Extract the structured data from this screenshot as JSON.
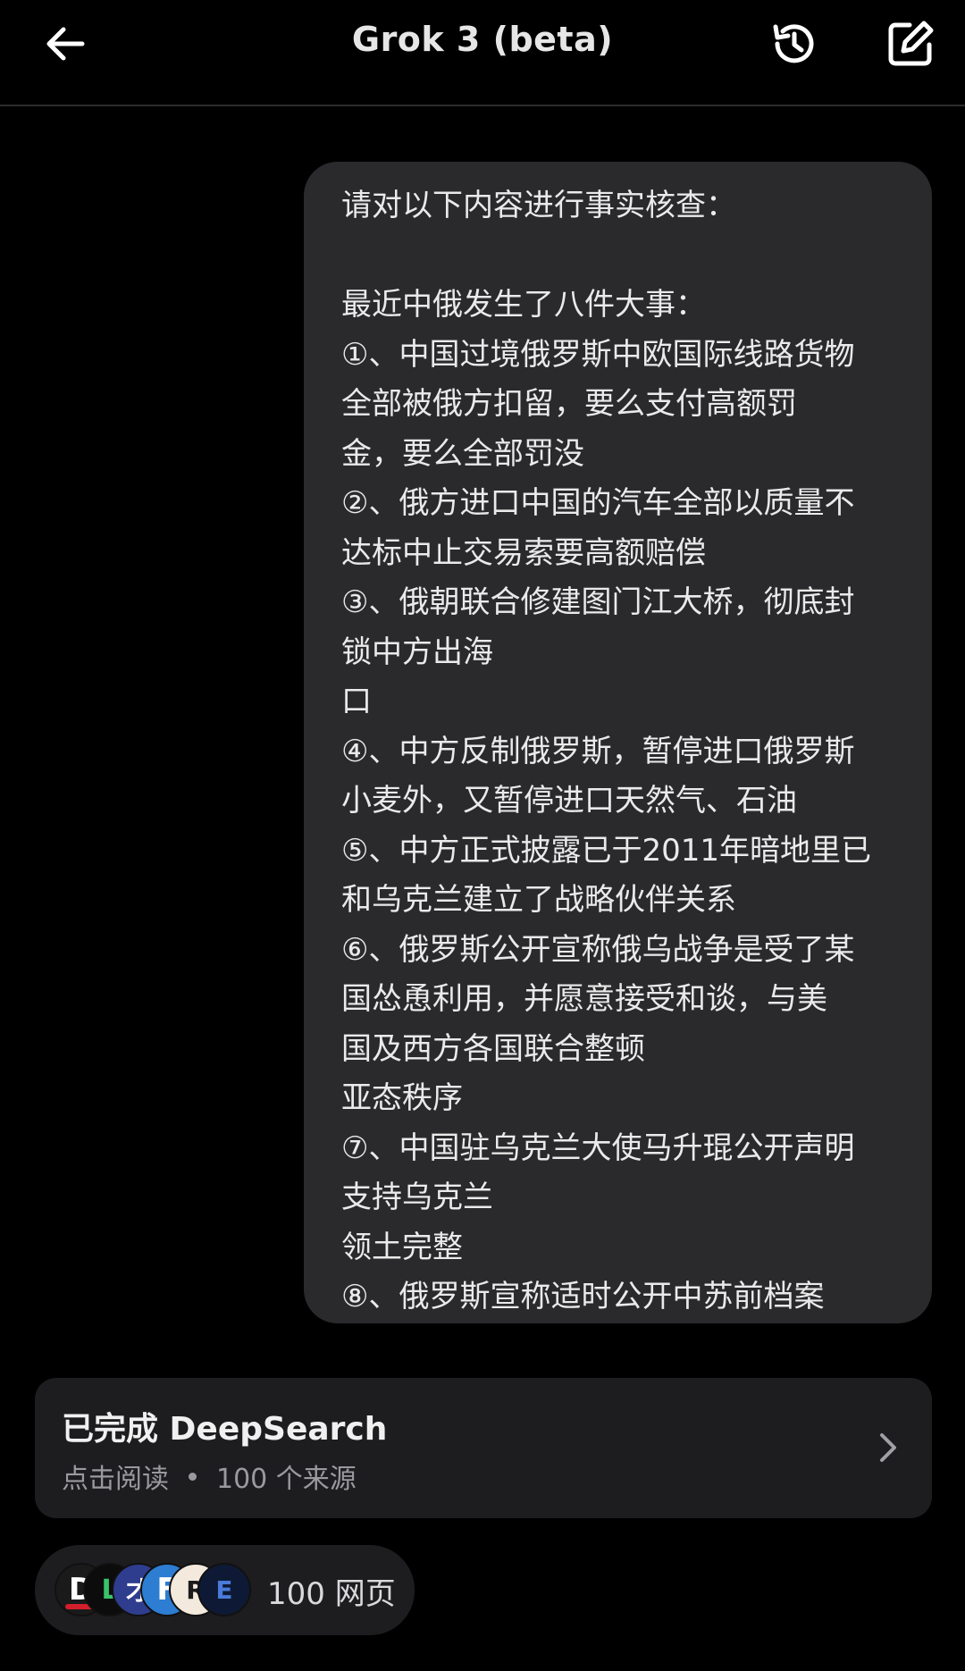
{
  "header": {
    "title": "Grok 3 (beta)",
    "back_icon": "arrow-left-icon",
    "history_icon": "history-icon",
    "compose_icon": "compose-icon"
  },
  "message": {
    "text": "请对以下内容进行事实核查：\n\n最近中俄发生了八件大事：\n①、中国过境俄罗斯中欧国际线路货物\n全部被俄方扣留，要么支付高额罚\n金，要么全部罚没\n②、俄方进口中国的汽车全部以质量不\n达标中止交易索要高额赔偿\n③、俄朝联合修建图门江大桥，彻底封\n锁中方出海\n口\n④、中方反制俄罗斯，暂停进口俄罗斯\n小麦外，又暂停进口天然气、石油\n⑤、中方正式披露已于2011年暗地里已\n和乌克兰建立了战略伙伴关系\n⑥、俄罗斯公开宣称俄乌战争是受了某\n国怂恿利用，并愿意接受和谈，与美\n国及西方各国联合整顿\n亚态秩序\n⑦、中国驻乌克兰大使马升琨公开声明\n支持乌克兰\n领土完整\n⑧、俄罗斯宣称适时公开中苏前档案"
  },
  "deepsearch": {
    "title": "已完成 DeepSearch",
    "action": "点击阅读",
    "sources": "100 个来源",
    "chevron_icon": "chevron-right-icon"
  },
  "sources_pill": {
    "label": "100 网页",
    "favicons": [
      "D",
      "L",
      "才",
      "F",
      "R",
      "E"
    ]
  },
  "colors": {
    "background": "#000000",
    "bubble": "#2a2a2d",
    "card": "#1d1d20",
    "text_primary": "#eaeaea",
    "text_secondary": "#9a9a9e"
  }
}
